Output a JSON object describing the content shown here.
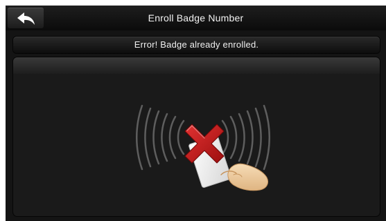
{
  "header": {
    "title": "Enroll Badge Number",
    "back_icon": "back-arrow-icon"
  },
  "status": {
    "message": "Error! Badge already enrolled."
  },
  "illustration": {
    "icons": [
      "rfid-signal-waves-icon",
      "badge-card-icon",
      "hand-icon",
      "error-x-icon"
    ]
  },
  "colors": {
    "screen_background": "#141414",
    "error_red": "#c41a1a",
    "skin": "#f0cfa2",
    "text": "#f0f0f0"
  }
}
